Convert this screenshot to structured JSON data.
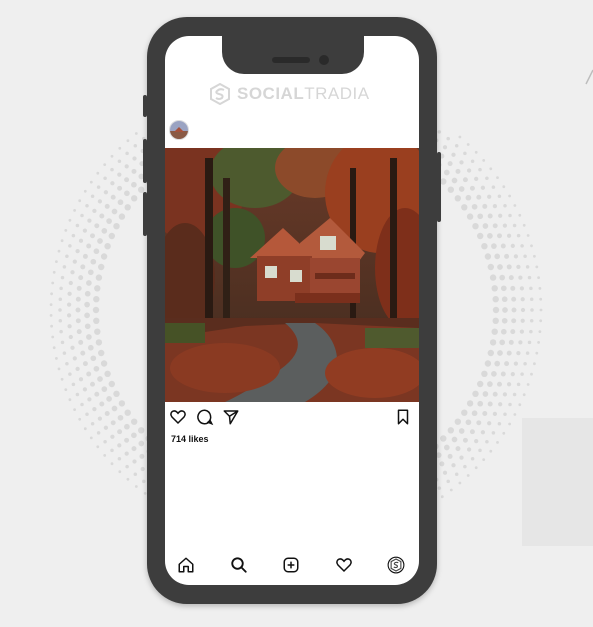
{
  "watermark": {
    "brand_bold": "SOCIAL",
    "brand_light": "TRADIA"
  },
  "post": {
    "likes_text": "714 likes",
    "image_icon": "autumn-cabin-photo"
  },
  "actions": {
    "like_icon": "heart-icon",
    "comment_icon": "comment-icon",
    "share_icon": "send-icon",
    "save_icon": "bookmark-icon"
  },
  "tabbar": {
    "items": [
      "home-icon",
      "search-icon",
      "add-post-icon",
      "activity-heart-icon",
      "profile-avatar"
    ]
  },
  "colors": {
    "phone_frame": "#3d3d3d",
    "background": "#efefef",
    "watermark": "#b5b5b5"
  }
}
